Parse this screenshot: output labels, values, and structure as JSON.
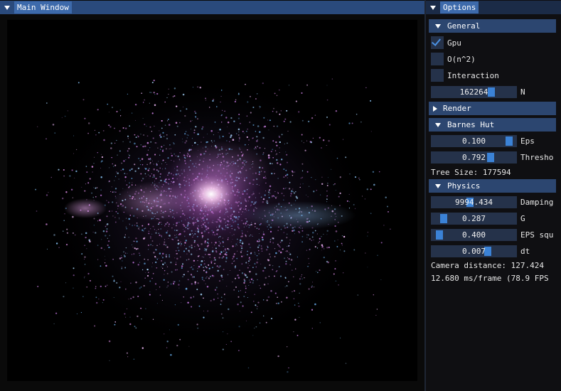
{
  "main_window": {
    "title": "Main Window"
  },
  "options": {
    "title": "Options",
    "general": {
      "header": "General",
      "checkboxes": [
        {
          "label": "Gpu",
          "checked": true
        },
        {
          "label": "O(n^2)",
          "checked": false
        },
        {
          "label": "Interaction",
          "checked": false
        }
      ],
      "n_slider": {
        "value": "162264",
        "label": "N",
        "fraction": 0.73
      }
    },
    "render": {
      "header": "Render"
    },
    "barnes_hut": {
      "header": "Barnes Hut",
      "sliders": [
        {
          "value": "0.100",
          "label": "Eps",
          "fraction": 0.96
        },
        {
          "value": "0.792",
          "label": "Thresho",
          "fraction": 0.72
        }
      ],
      "tree_size": "Tree Size: 177594"
    },
    "physics": {
      "header": "Physics",
      "sliders": [
        {
          "value": "9994.434",
          "label": "Damping",
          "fraction": 0.45
        },
        {
          "value": "0.287",
          "label": "G",
          "fraction": 0.1
        },
        {
          "value": "0.400",
          "label": "EPS squ",
          "fraction": 0.05
        },
        {
          "value": "0.007",
          "label": "dt",
          "fraction": 0.68
        }
      ],
      "camera_distance": "Camera distance: 127.424",
      "frame_time": "12.680 ms/frame (78.9 FPS"
    }
  },
  "colors": {
    "title_bar": "#2a4a7c",
    "header": "#2c4670",
    "frame_bg": "#25324a",
    "slider_grab": "#3b82d6",
    "check": "#4a90e2"
  }
}
